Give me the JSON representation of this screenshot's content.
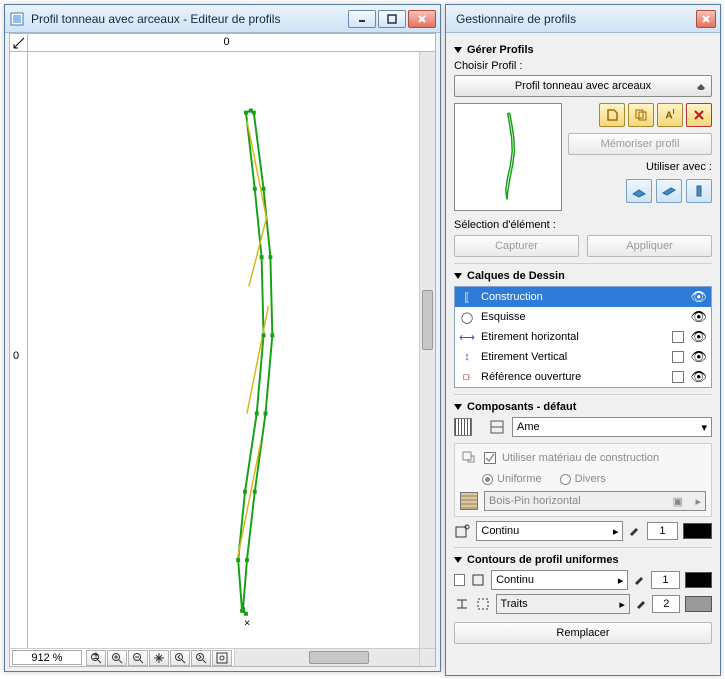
{
  "editor": {
    "title": "Profil tonneau avec arceaux - Editeur de profils",
    "ruler_h_mark": "0",
    "ruler_v_mark": "0",
    "zoom": "912 %"
  },
  "manager": {
    "title": "Gestionnaire de profils",
    "sections": {
      "manage": "Gérer Profils",
      "layers": "Calques de Dessin",
      "components": "Composants - défaut",
      "contours": "Contours de profil uniformes"
    },
    "choose_label": "Choisir Profil :",
    "profile_combo": "Profil tonneau avec arceaux",
    "store_btn": "Mémoriser profil",
    "use_with_label": "Utiliser avec :",
    "selection_label": "Sélection d'élément :",
    "capture_btn": "Capturer",
    "apply_btn": "Appliquer",
    "layers_list": [
      {
        "name": "Construction",
        "selected": true,
        "check": null
      },
      {
        "name": "Esquisse",
        "selected": false,
        "check": null
      },
      {
        "name": "Etirement horizontal",
        "selected": false,
        "check": false
      },
      {
        "name": "Etirement Vertical",
        "selected": false,
        "check": false
      },
      {
        "name": "Référence ouverture",
        "selected": false,
        "check": false
      }
    ],
    "component_combo": "Ame",
    "material_check_label": "Utiliser matériau de construction",
    "material_uniform": "Uniforme",
    "material_divers": "Divers",
    "material_combo": "Bois-Pin horizontal",
    "pen_line_combo": "Continu",
    "pen_line_value": "1",
    "contour1_combo": "Continu",
    "contour1_value": "1",
    "contour2_combo": "Traits",
    "contour2_value": "2",
    "replace_btn": "Remplacer"
  },
  "chart_data": {
    "type": "line",
    "title": "Profil tonneau avec arceaux",
    "xlabel": "",
    "ylabel": "",
    "series": [
      {
        "name": "outline",
        "color": "#16a016",
        "points": [
          [
            228,
            60
          ],
          [
            231,
            62
          ],
          [
            241,
            140
          ],
          [
            248,
            210
          ],
          [
            250,
            290
          ],
          [
            243,
            370
          ],
          [
            232,
            450
          ],
          [
            224,
            520
          ],
          [
            220,
            570
          ],
          [
            223,
            575
          ],
          [
            219,
            572
          ],
          [
            215,
            520
          ],
          [
            222,
            450
          ],
          [
            234,
            370
          ],
          [
            241,
            290
          ],
          [
            239,
            210
          ],
          [
            232,
            140
          ],
          [
            223,
            62
          ],
          [
            228,
            60
          ]
        ]
      },
      {
        "name": "arc-diagonals",
        "color": "#d8b51a",
        "segments": [
          [
            [
              224,
              70
            ],
            [
              244,
              170
            ]
          ],
          [
            [
              244,
              170
            ],
            [
              226,
              240
            ]
          ],
          [
            [
              246,
              260
            ],
            [
              224,
              370
            ]
          ],
          [
            [
              238,
              400
            ],
            [
              214,
              520
            ]
          ]
        ]
      }
    ]
  }
}
